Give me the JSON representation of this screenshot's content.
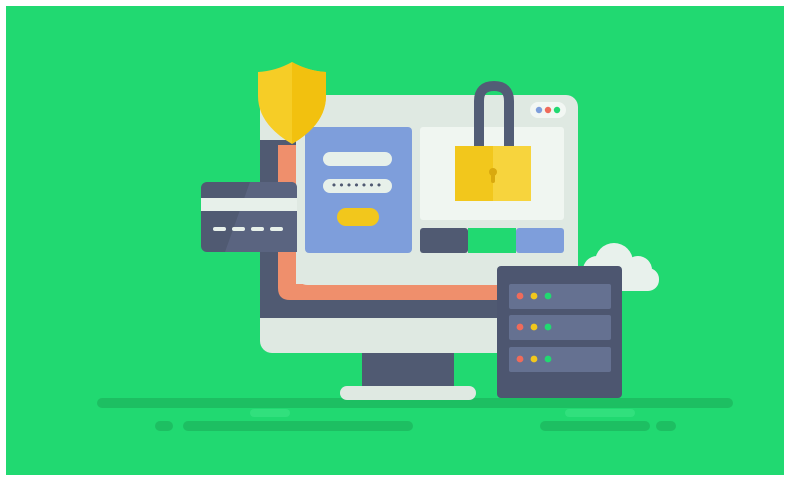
{
  "illustration": {
    "password_mask": "•••••••",
    "icons": [
      "shield-icon",
      "padlock-icon",
      "credit-card-icon",
      "cloud-icon",
      "server-rack-icon",
      "monitor-icon"
    ]
  },
  "colors": {
    "background": "#21d971",
    "ground": "#1dbf62",
    "monitor_frame": "#dfe9e2",
    "monitor_bezel": "#505a72",
    "screen_accent": "#ef8f6c",
    "login_card": "#7e9edb",
    "field": "#e7f0ea",
    "login_button": "#f2c71c",
    "lock_body": "#f2c71c",
    "lock_shackle": "#525d76",
    "shield": "#f6cd26",
    "server_body": "#4d5670",
    "server_slot": "#657191",
    "led_red": "#ef6b5a",
    "led_yellow": "#f2c71c",
    "led_green": "#21d971",
    "cloud": "#e8f1ec"
  }
}
